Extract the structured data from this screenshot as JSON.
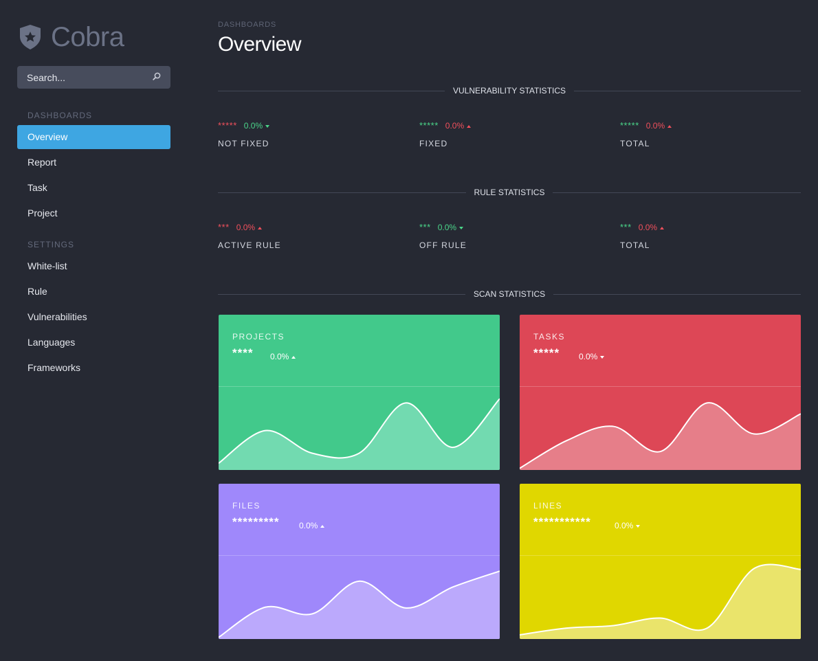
{
  "sidebar": {
    "brand": "Cobra",
    "brand_icon": "shield-star-icon",
    "search_placeholder": "Search...",
    "search_icon": "search-icon",
    "dashboards_heading": "DASHBOARDS",
    "dashboard_items": [
      "Overview",
      "Report",
      "Task",
      "Project"
    ],
    "active_item": "Overview",
    "settings_heading": "SETTINGS",
    "settings_items": [
      "White-list",
      "Rule",
      "Vulnerabilities",
      "Languages",
      "Frameworks"
    ]
  },
  "header": {
    "breadcrumb": "DASHBOARDS",
    "title": "Overview"
  },
  "vulnerability": {
    "title": "VULNERABILITY STATISTICS",
    "stats": [
      {
        "value": "*****",
        "pct": "0.0%",
        "trend": "down",
        "caption": "NOT FIXED",
        "value_color": "#f0505c",
        "pct_color": "#4bd68a"
      },
      {
        "value": "*****",
        "pct": "0.0%",
        "trend": "up",
        "caption": "FIXED",
        "value_color": "#4bd68a",
        "pct_color": "#f0505c"
      },
      {
        "value": "*****",
        "pct": "0.0%",
        "trend": "up",
        "caption": "TOTAL",
        "value_color": "#4bd68a",
        "pct_color": "#f0505c"
      }
    ]
  },
  "rule": {
    "title": "RULE STATISTICS",
    "stats": [
      {
        "value": "***",
        "pct": "0.0%",
        "trend": "up",
        "caption": "ACTIVE RULE",
        "value_color": "#f0505c",
        "pct_color": "#f0505c"
      },
      {
        "value": "***",
        "pct": "0.0%",
        "trend": "down",
        "caption": "OFF RULE",
        "value_color": "#4bd68a",
        "pct_color": "#4bd68a"
      },
      {
        "value": "***",
        "pct": "0.0%",
        "trend": "up",
        "caption": "TOTAL",
        "value_color": "#4bd68a",
        "pct_color": "#f0505c"
      }
    ]
  },
  "scan": {
    "title": "SCAN STATISTICS",
    "cards": [
      {
        "title": "PROJECTS",
        "value": "****",
        "pct": "0.0%",
        "trend": "up",
        "color": "#42c98b",
        "fill": "#72dab0",
        "points": [
          0.08,
          0.47,
          0.2,
          0.2,
          0.8,
          0.27,
          0.85
        ]
      },
      {
        "title": "TASKS",
        "value": "*****",
        "pct": "0.0%",
        "trend": "down",
        "color": "#dd4756",
        "fill": "#e67e89",
        "points": [
          0.02,
          0.35,
          0.52,
          0.22,
          0.8,
          0.43,
          0.67
        ]
      },
      {
        "title": "FILES",
        "value": "*********",
        "pct": "0.0%",
        "trend": "up",
        "color": "#9f88fb",
        "fill": "#bba9fc",
        "points": [
          0.02,
          0.38,
          0.3,
          0.69,
          0.37,
          0.62,
          0.81
        ]
      },
      {
        "title": "LINES",
        "value": "***********",
        "pct": "0.0%",
        "trend": "down",
        "color": "#e0d700",
        "fill": "#eae46b",
        "points": [
          0.05,
          0.13,
          0.16,
          0.25,
          0.13,
          0.84,
          0.83
        ]
      }
    ]
  }
}
